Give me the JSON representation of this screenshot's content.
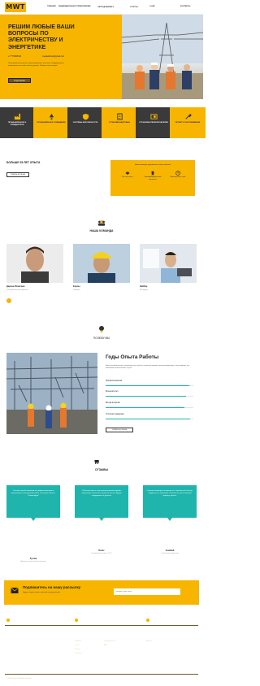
{
  "header": {
    "logo": "MWT",
    "nav": [
      "ГЛАВНАЯ",
      "ИНДИВИДУАЛЬНОЕ ПРЕДЛОЖЕНИЕ",
      "ОБОРУДОВАНИЕ ▾",
      "УСЛУГИ ▾",
      "О НАС",
      "КОНТАКТЫ"
    ]
  },
  "hero": {
    "title": "РЕШИМ ЛЮБЫЕ ВАШИ ВОПРОСЫ ПО ЭЛЕКТРИЧЕСТВУ И ЭНЕРГЕТИКЕ",
    "phone": "+7 7772865040",
    "email": "megawattruss@gmail.com",
    "description": "Электромонтаж работы, проектирование, поставка оборудования и инженерные системы любого уровня. Звоните нам сегодня!",
    "button": "ПОДРОБНЕЕ"
  },
  "features": [
    "ПРОМЫШЛЕННОЕ И ГРАЖДАНСКОЕ",
    "ПРОМЫШЛЕННОЕ ОСВЕЩЕНИЕ",
    "СИСТЕМЫ БЕЗОПАСНОСТИ",
    "УСТАНОВКА ЩИТОВЫХ",
    "УСТАНОВКА ПЕРЕКЛЮЧАТЕЛЕЙ",
    "ПРОЕКТ И ОБСЛУЖИВАНИЕ"
  ],
  "about": {
    "title": "БОЛЬШЕ 25 ЛЕТ ОПЫТА",
    "button": "УЗНАТЬ БОЛЬШЕ",
    "stats_heading": "Наша команда, уверенная и ответственная",
    "stats": [
      "Мы честность",
      "Квалифицированный персонал",
      "Выполнение в срок"
    ]
  },
  "team": {
    "title": "НАША КОМАНДА",
    "members": [
      {
        "name": "Дархан Исмагиев",
        "role": "Главный инженер-энергетик"
      },
      {
        "name": "Ералы",
        "role": "Электрик"
      },
      {
        "name": "Кайбар",
        "role": "Менеджер"
      }
    ]
  },
  "why": {
    "title": "ПОЧЕМУ МЫ",
    "heading": "Годы Опыта Работы",
    "description": "Наш коллектив имеет огромный опыт работы в разных сферах электроэнергетики, и мы уверены что выполним любой объект в срок.",
    "bars": [
      {
        "label": "Профессионализм",
        "value": 0.95
      },
      {
        "label": "Большой опыт",
        "value": 0.92
      },
      {
        "label": "Всегда во время",
        "value": 0.9
      },
      {
        "label": "Отличная поддержка",
        "value": 0.96
      }
    ],
    "button": "УЗНАТЬ БОЛЬШЕ"
  },
  "reviews": {
    "quote_mark": "❞",
    "title": "ОТЗЫВЫ",
    "items": [
      {
        "text": "Спасибо вашей компании за профессионализм и оперативность выполнения работ на нашем объекте. Рекомендую!",
        "name": "Руслан",
        "role": "Директор строительной компании"
      },
      {
        "text": "Работали вместе над проектом реконструкции подстанции. Качество и сроки на высоте. Будем сотрудничать и дальше.",
        "name": "Болат",
        "role": "Руководитель отдела ТОО"
      },
      {
        "text": "Отличная команда специалистов. Сделали всё быстро, аккуратно и с гарантией. Спасибо за ответственный подход к работе.",
        "name": "Алмабай",
        "role": "Генеральный директор"
      }
    ]
  },
  "subscribe": {
    "title": "Подпишитесь на нашу рассылку",
    "description": "Будьте в курсе наших новостей и предложений",
    "placeholder": "Введите ваш email"
  },
  "footer": {
    "phone": "+7 777 286 50 11",
    "email": "megawatt.kaz@gmail.com",
    "hours": "Пн-Пт 09:00 - 18:00",
    "logo": "MWT.KZ",
    "links_title": "Ссылки",
    "links": [
      "Главная",
      "О нас",
      "Услуги",
      "Контакты"
    ],
    "links2": [
      "Оборудование",
      "FAQ"
    ],
    "city_title": "Города",
    "city": "Алматы",
    "copyright": "© 2024 mwt.kz. All rights reserved."
  },
  "colors": {
    "accent": "#f7b500",
    "teal": "#1fb5ad",
    "dark": "#3a2d0d",
    "feature_dark": "#3a3a3a"
  }
}
